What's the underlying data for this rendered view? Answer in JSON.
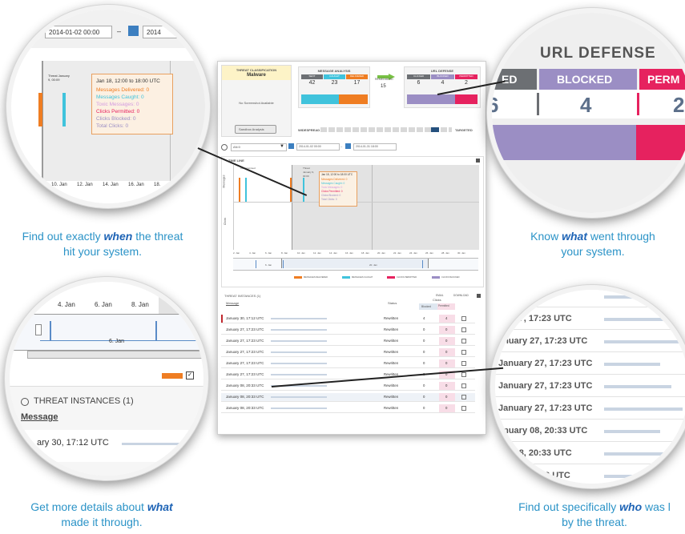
{
  "app": {
    "threat_classification": {
      "header": "THREAT CLASSIFICATION",
      "value": "Malware"
    },
    "no_screenshot": "No Screenshot Available",
    "sandbox_button": "Sandbox Analysis",
    "message_analysis": {
      "title": "MESSAGE ANALYSIS",
      "columns": [
        "SENT",
        "CAUGHT",
        "DELIVERED"
      ],
      "values": [
        "42",
        "23",
        "17"
      ],
      "remediated_label": "REMEDIATED",
      "remediated_value": "15"
    },
    "url_defense": {
      "title": "URL DEFENSE",
      "columns": [
        "CLICKED",
        "BLOCKED",
        "PERMITTED"
      ],
      "values": [
        "6",
        "4",
        "2"
      ]
    },
    "spread": {
      "left": "WIDESPREAD",
      "right": "TARGETED"
    },
    "filter": {
      "selector": "AN:0",
      "start": "2014-01-02 00:00",
      "end": "2014-01-31 18:00"
    },
    "timeline": {
      "title": "TIME LINE",
      "y_top": "Messages",
      "y_bottom": "Clicks",
      "x_ticks": [
        "2. Jan",
        "4. Jan",
        "6. Jan",
        "8. Jan",
        "10. Jan",
        "12. Jan",
        "14. Jan",
        "16. Jan",
        "18. Jan",
        "20. Jan",
        "22. Jan",
        "24. Jan",
        "26. Jan",
        "28. Jan",
        "30. Jan"
      ],
      "nav_ticks": [
        "6. Jan",
        "20. Jan"
      ],
      "label_left": "Compromised",
      "label_mid": "Threat January 9, 00:09",
      "tooltip": {
        "title": "Jan 18, 12:00 to 18:00 UTC",
        "delivered": "Messages Delivered: 0",
        "caught": "Messages Caught: 0",
        "toxic": "Toxic Messages: 0",
        "permitted": "Clicks Permitted: 0",
        "blocked": "Clicks Blocked: 0",
        "total": "Total Clicks: 0"
      },
      "legend": [
        "MESSAGES DELIVERED",
        "MESSAGES CAUGHT",
        "CLICKS PERMITTED",
        "CLICKS BLOCKED"
      ]
    },
    "instances": {
      "title": "THREAT INSTANCES (1)",
      "email_label": "EMAIL",
      "download_label": "DOWNLOAD",
      "col_message": "Message",
      "col_status": "Status",
      "col_clicks": "Clicks",
      "col_blocked": "Blocked",
      "col_permitted": "Permitted",
      "rows": [
        {
          "date": "January 30, 17:12 UTC",
          "status": "Rewritten",
          "blocked": "4",
          "permitted": "4"
        },
        {
          "date": "January 27, 17:23 UTC",
          "status": "Rewritten",
          "blocked": "0",
          "permitted": "0"
        },
        {
          "date": "January 27, 17:23 UTC",
          "status": "Rewritten",
          "blocked": "0",
          "permitted": "0"
        },
        {
          "date": "January 27, 17:23 UTC",
          "status": "Rewritten",
          "blocked": "0",
          "permitted": "0"
        },
        {
          "date": "January 27, 17:23 UTC",
          "status": "Rewritten",
          "blocked": "0",
          "permitted": "0"
        },
        {
          "date": "January 27, 17:23 UTC",
          "status": "Rewritten",
          "blocked": "0",
          "permitted": "0"
        },
        {
          "date": "January 08, 20:33 UTC",
          "status": "Rewritten",
          "blocked": "0",
          "permitted": "0"
        },
        {
          "date": "January 08, 20:33 UTC",
          "status": "Rewritten",
          "blocked": "0",
          "permitted": "0"
        },
        {
          "date": "January 08, 20:33 UTC",
          "status": "Rewritten",
          "blocked": "0",
          "permitted": "0"
        }
      ]
    }
  },
  "zoom_timeline": {
    "date_from": "2014-01-02 00:00",
    "date_to": "2014",
    "threat_label": "Threat January 9, 00:09",
    "tooltip_title": "Jan 18, 12:00 to 18:00 UTC",
    "tooltip_delivered": "Messages Delivered: 0",
    "tooltip_caught": "Messages Caught: 0",
    "tooltip_toxic": "Toxic Messages: 0",
    "tooltip_permitted": "Clicks Permitted: 0",
    "tooltip_blocked": "Clicks Blocked: 0",
    "tooltip_total": "Total Clicks: 0",
    "ticks": [
      "10. Jan",
      "12. Jan",
      "14. Jan",
      "16. Jan",
      "18."
    ]
  },
  "zoom_url": {
    "title": "URL DEFENSE",
    "col_left": "ED",
    "col_blocked": "BLOCKED",
    "col_right": "PERM",
    "val_left": "6",
    "val_blocked": "4",
    "val_right": "2"
  },
  "zoom_instances": {
    "ticks": [
      "4. Jan",
      "6. Jan",
      "8. Jan"
    ],
    "nav_tick": "6. Jan",
    "title": "THREAT INSTANCES (1)",
    "col_message": "Message",
    "row_date": "ary 30, 17:12 UTC"
  },
  "zoom_who": {
    "rows": [
      "UTC",
      "ary 27, 17:23 UTC",
      "anuary 27, 17:23 UTC",
      "January 27, 17:23 UTC",
      "January 27, 17:23 UTC",
      "January 27, 17:23 UTC",
      "anuary 08, 20:33 UTC",
      "ary 08, 20:33 UTC",
      "20:33 UTC"
    ]
  },
  "captions": {
    "when": {
      "pre": "Find out exactly ",
      "em": "when",
      "post": " the threat",
      "line2": "hit your system."
    },
    "what_through": {
      "pre": "Know ",
      "em": "what",
      "post": " went through",
      "line2": "your system."
    },
    "what_details": {
      "pre": "Get more details about ",
      "em": "what",
      "post": "",
      "line2": "made it through."
    },
    "who": {
      "pre": "Find out specifically ",
      "em": "who",
      "post": " was l",
      "line2": "by the threat."
    }
  },
  "colors": {
    "delivered": "#ef7d22",
    "caught": "#40c3dc",
    "permitted": "#e6225f",
    "blocked": "#9b8ec4",
    "caption": "#2b93c7",
    "caption_em": "#1d63b5",
    "classification": "#fdf3c7",
    "arrow": "#77c043"
  }
}
